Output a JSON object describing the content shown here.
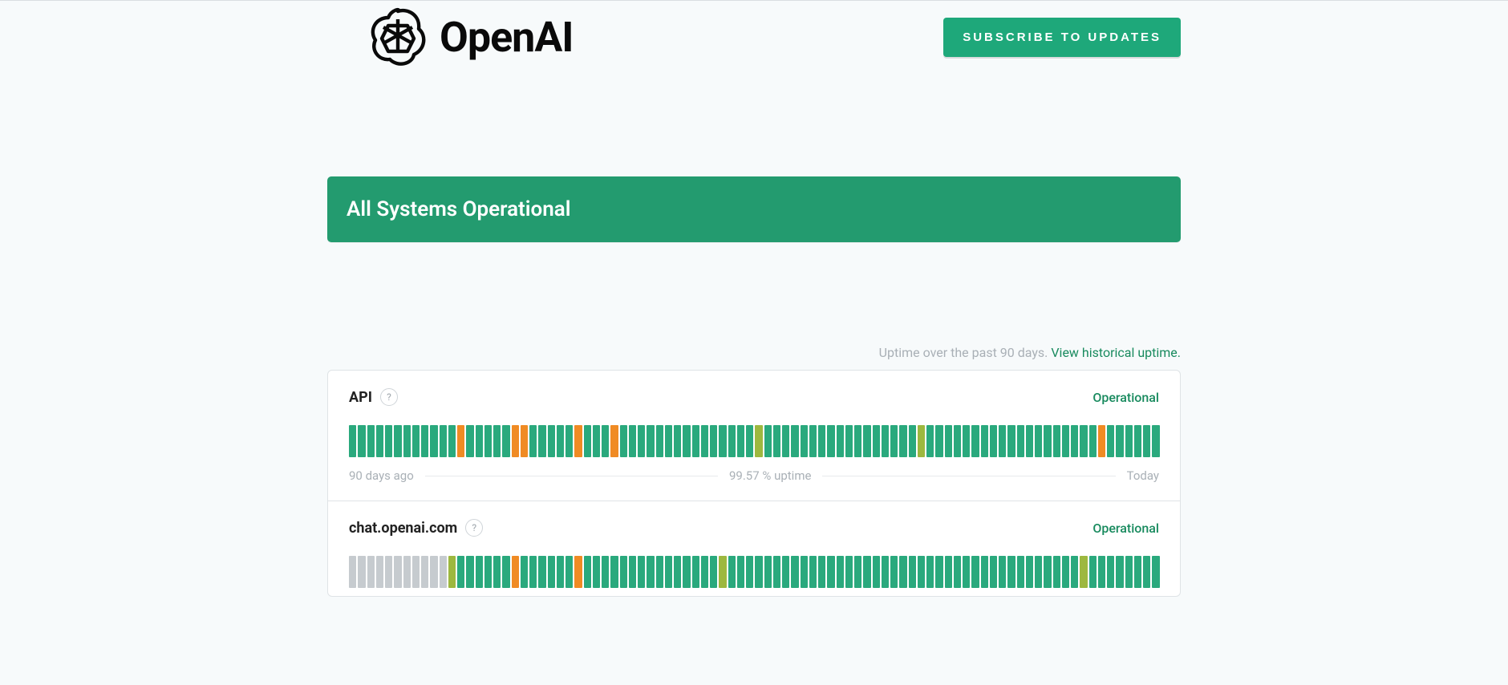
{
  "header": {
    "brand": "OpenAI",
    "subscribe_label": "SUBSCRIBE TO UPDATES"
  },
  "banner": {
    "text": "All Systems Operational"
  },
  "uptime_caption": {
    "prefix": "Uptime over the past 90 days. ",
    "link": "View historical uptime."
  },
  "legend": {
    "left": "90 days ago",
    "right": "Today"
  },
  "components": [
    {
      "name": "API",
      "status": "Operational",
      "uptime_text": "99.57 % uptime",
      "bars": [
        "g",
        "g",
        "g",
        "g",
        "g",
        "g",
        "g",
        "g",
        "g",
        "g",
        "g",
        "g",
        "o",
        "g",
        "g",
        "g",
        "g",
        "g",
        "o",
        "o",
        "g",
        "g",
        "g",
        "g",
        "g",
        "o",
        "g",
        "g",
        "g",
        "o",
        "g",
        "g",
        "g",
        "g",
        "g",
        "g",
        "g",
        "g",
        "g",
        "g",
        "g",
        "g",
        "g",
        "g",
        "g",
        "y",
        "g",
        "g",
        "g",
        "g",
        "g",
        "g",
        "g",
        "g",
        "g",
        "g",
        "g",
        "g",
        "g",
        "g",
        "g",
        "g",
        "g",
        "y",
        "g",
        "g",
        "g",
        "g",
        "g",
        "g",
        "g",
        "g",
        "g",
        "g",
        "g",
        "g",
        "g",
        "g",
        "g",
        "g",
        "g",
        "g",
        "g",
        "o",
        "g",
        "g",
        "g",
        "g",
        "g",
        "g"
      ]
    },
    {
      "name": "chat.openai.com",
      "status": "Operational",
      "uptime_text": "",
      "bars": [
        "n",
        "n",
        "n",
        "n",
        "n",
        "n",
        "n",
        "n",
        "n",
        "n",
        "n",
        "y",
        "g",
        "g",
        "g",
        "g",
        "g",
        "g",
        "o",
        "g",
        "g",
        "g",
        "g",
        "g",
        "g",
        "o",
        "g",
        "g",
        "g",
        "g",
        "g",
        "g",
        "g",
        "g",
        "g",
        "g",
        "g",
        "g",
        "g",
        "g",
        "g",
        "y",
        "g",
        "g",
        "g",
        "g",
        "g",
        "g",
        "g",
        "g",
        "g",
        "g",
        "g",
        "g",
        "g",
        "g",
        "g",
        "g",
        "g",
        "g",
        "g",
        "g",
        "g",
        "g",
        "g",
        "g",
        "g",
        "g",
        "g",
        "g",
        "g",
        "g",
        "g",
        "g",
        "g",
        "g",
        "g",
        "g",
        "g",
        "g",
        "g",
        "y",
        "g",
        "g",
        "g",
        "g",
        "g",
        "g",
        "g",
        "g"
      ]
    }
  ]
}
